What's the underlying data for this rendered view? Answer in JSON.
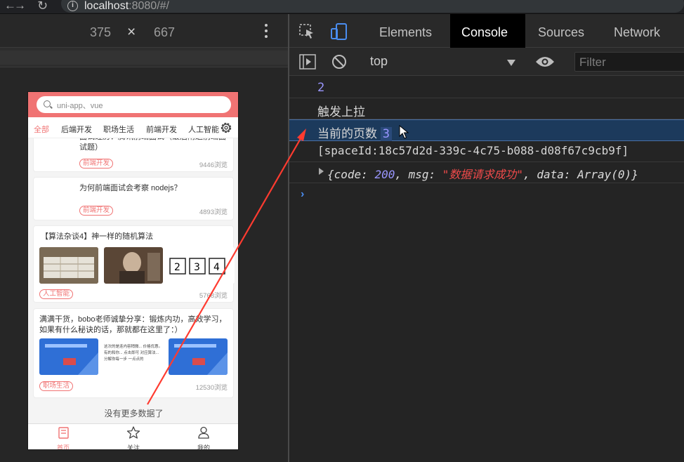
{
  "browser": {
    "url_host": "localhost",
    "url_rest": ":8080/#/"
  },
  "device": {
    "width": "375",
    "times": "×",
    "height": "667"
  },
  "phone": {
    "search_placeholder": "uni-app、vue",
    "tabs": [
      "全部",
      "后端开发",
      "职场生活",
      "前端开发",
      "人工智能"
    ],
    "cards": [
      {
        "title": "面试经历：腾讯前端面试（最后附送前端面试题）",
        "tag": "前端开发",
        "views": "9446浏览"
      },
      {
        "title": "为何前端面试会考察 nodejs？",
        "tag": "前端开发",
        "views": "4893浏览"
      },
      {
        "title": "【算法杂谈4】神一样的随机算法",
        "tag": "人工智能",
        "views": "5768浏览"
      },
      {
        "title": "满满干货，bobo老师诚挚分享：锻炼内功，高效学习，如果有什么秘诀的话，那就都在这里了：）",
        "tag": "职场生活",
        "views": "12530浏览",
        "middle_text": "这次的是连内容稍微... 价格优惠。 有的和你... 点击即可 对应算法... 分解你每一步 一点点的"
      }
    ],
    "end_text": "没有更多数据了",
    "nav": [
      "首页",
      "关注",
      "我的"
    ]
  },
  "devtools": {
    "tabs": [
      "Elements",
      "Console",
      "Sources",
      "Network"
    ],
    "active_tab": "Console",
    "context": "top",
    "filter_placeholder": "Filter",
    "console": {
      "line1": "2",
      "line2": "触发上拉",
      "line3_label": "当前的页数",
      "line3_value": "3",
      "line4": "[spaceId:18c57d2d-339c-4c75-b088-d08f67c9cb9f]",
      "line5": {
        "key_code": "code",
        "code": "200",
        "key_msg": "msg",
        "msg": "\"数据请求成功\"",
        "key_data": "data",
        "data": "Array(0)"
      }
    }
  },
  "colors": {
    "accent": "#f07373",
    "console_number": "#9a96ff",
    "console_string": "#ef4a4a",
    "annotation_arrow": "#ff3b30"
  }
}
